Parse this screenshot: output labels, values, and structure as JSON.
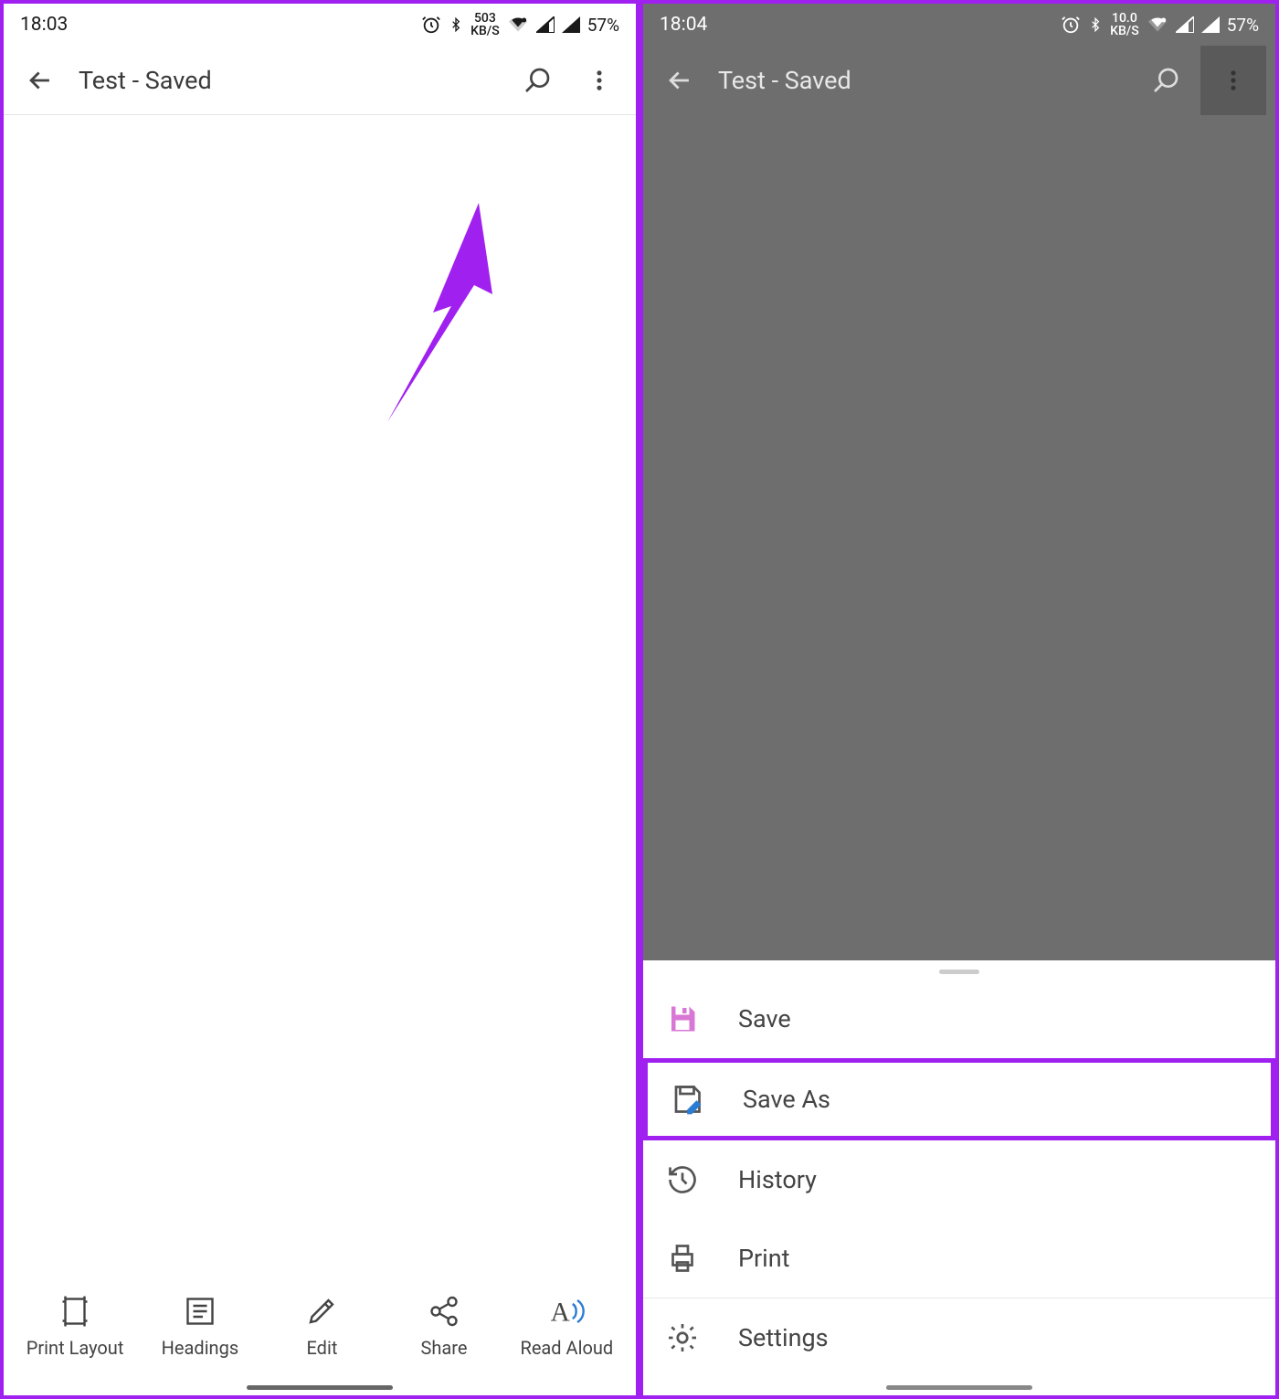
{
  "left": {
    "status": {
      "time": "18:03",
      "net_top": "503",
      "net_bot": "KB/S",
      "battery": "57%"
    },
    "app_bar": {
      "title": "Test - Saved"
    },
    "bottom": [
      {
        "icon": "print-layout",
        "label": "Print Layout"
      },
      {
        "icon": "headings",
        "label": "Headings"
      },
      {
        "icon": "edit",
        "label": "Edit"
      },
      {
        "icon": "share",
        "label": "Share"
      },
      {
        "icon": "read-aloud",
        "label": "Read Aloud"
      }
    ]
  },
  "right": {
    "status": {
      "time": "18:04",
      "net_top": "10.0",
      "net_bot": "KB/S",
      "battery": "57%"
    },
    "app_bar": {
      "title": "Test - Saved"
    },
    "menu": [
      {
        "icon": "save",
        "label": "Save",
        "highlight": false
      },
      {
        "icon": "save-as",
        "label": "Save As",
        "highlight": true
      },
      {
        "icon": "history",
        "label": "History",
        "highlight": false
      },
      {
        "icon": "print",
        "label": "Print",
        "highlight": false
      },
      {
        "icon": "settings",
        "label": "Settings",
        "highlight": false
      }
    ]
  },
  "colors": {
    "accent": "#a020f0",
    "save_pink": "#d977d5",
    "read_aloud_blue": "#2b7cd3"
  }
}
